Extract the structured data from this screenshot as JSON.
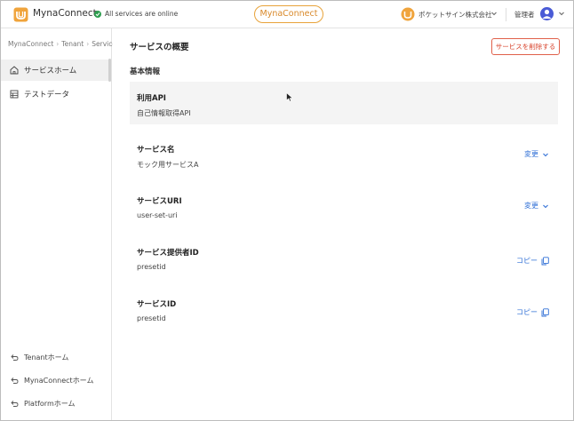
{
  "header": {
    "app_name": "MynaConnect",
    "status_text": "All services are online",
    "center_pill": "MynaConnect",
    "org_name": "ポケットサイン株式会社",
    "user_role": "管理者"
  },
  "sidebar": {
    "breadcrumb": [
      "MynaConnect",
      "Tenant",
      "Service"
    ],
    "nav": [
      {
        "label": "サービスホーム",
        "icon": "home-icon",
        "active": true
      },
      {
        "label": "テストデータ",
        "icon": "table-icon",
        "active": false
      }
    ],
    "footer": [
      {
        "label": "Tenantホーム",
        "icon": "return-icon"
      },
      {
        "label": "MynaConnectホーム",
        "icon": "return-icon"
      },
      {
        "label": "Platformホーム",
        "icon": "return-icon"
      }
    ]
  },
  "main": {
    "title": "サービスの概要",
    "delete_button": "サービスを削除する",
    "section_title": "基本情報",
    "rows": [
      {
        "label": "利用API",
        "value": "自己情報取得API",
        "action": ""
      },
      {
        "label": "サービス名",
        "value": "モック用サービスA",
        "action": "変更"
      },
      {
        "label": "サービスURI",
        "value": "user-set-uri",
        "action": "変更"
      },
      {
        "label": "サービス提供者ID",
        "value": "presetid",
        "action": "コピー"
      },
      {
        "label": "サービスID",
        "value": "presetid",
        "action": "コピー"
      }
    ]
  },
  "colors": {
    "accent_orange": "#e8a33a",
    "danger": "#d8442d",
    "link_blue": "#2f6fd6",
    "online_green": "#2e9e4f"
  }
}
